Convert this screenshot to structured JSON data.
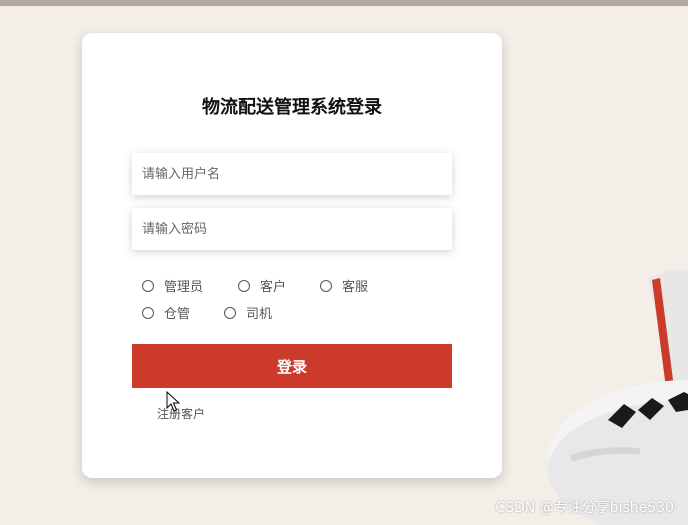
{
  "login": {
    "title": "物流配送管理系统登录",
    "username_placeholder": "请输入用户名",
    "password_placeholder": "请输入密码",
    "roles": [
      "管理员",
      "客户",
      "客服",
      "仓管",
      "司机"
    ],
    "login_label": "登录",
    "register_label": "注册客户"
  },
  "watermark": "CSDN @专注分享bishe530",
  "colors": {
    "background": "#f3eee8",
    "card": "#ffffff",
    "primary_button": "#cc3a2c"
  }
}
